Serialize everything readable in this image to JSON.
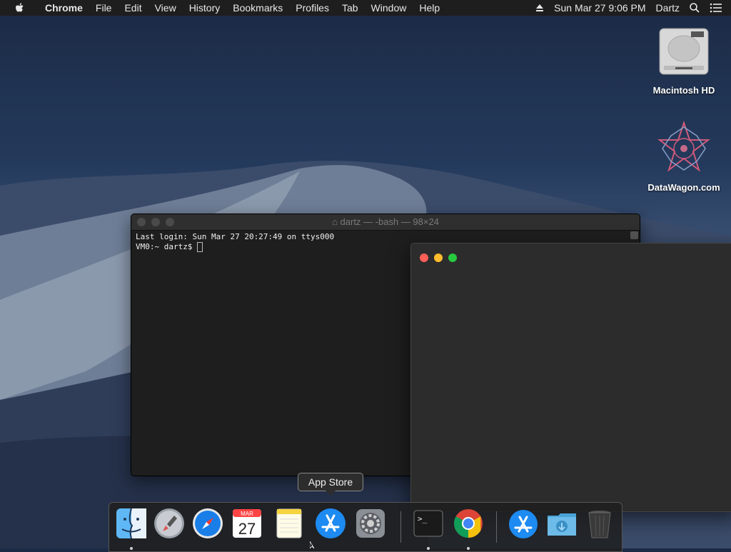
{
  "menubar": {
    "app_name": "Chrome",
    "items": [
      "File",
      "Edit",
      "View",
      "History",
      "Bookmarks",
      "Profiles",
      "Tab",
      "Window",
      "Help"
    ],
    "clock": "Sun Mar 27  9:06 PM",
    "user": "Dartz"
  },
  "desktop": {
    "icons": [
      {
        "label": "Macintosh HD",
        "icon": "hard-drive-icon"
      },
      {
        "label": "DataWagon.com",
        "icon": "datawagon-logo-icon"
      }
    ]
  },
  "terminal": {
    "title": "dartz — -bash — 98×24",
    "lines": [
      "Last login: Sun Mar 27 20:27:49 on ttys000",
      "VM0:~ dartz$ "
    ]
  },
  "tooltip": "App Store",
  "dock": {
    "items": [
      {
        "name": "Finder",
        "icon": "finder-icon",
        "running": true
      },
      {
        "name": "Launchpad",
        "icon": "launchpad-icon",
        "running": false
      },
      {
        "name": "Safari",
        "icon": "safari-icon",
        "running": false
      },
      {
        "name": "Calendar",
        "icon": "calendar-icon",
        "running": false,
        "month": "MAR",
        "day": "27"
      },
      {
        "name": "Notes",
        "icon": "notes-icon",
        "running": false
      },
      {
        "name": "App Store",
        "icon": "app-store-icon",
        "running": false
      },
      {
        "name": "System Preferences",
        "icon": "system-preferences-icon",
        "running": false
      },
      {
        "name": "Terminal",
        "icon": "terminal-icon",
        "running": true
      },
      {
        "name": "Google Chrome",
        "icon": "chrome-icon",
        "running": true
      },
      {
        "name": "Downloads stack",
        "icon": "app-store-download-icon",
        "running": false
      },
      {
        "name": "Downloads",
        "icon": "downloads-folder-icon",
        "running": false
      },
      {
        "name": "Trash",
        "icon": "trash-icon",
        "running": false
      }
    ]
  },
  "colors": {
    "close": "#fe5f57",
    "minimize": "#febc2e",
    "zoom": "#28c840",
    "safari_blue": "#1a7ee8",
    "chrome_red": "#db4437",
    "chrome_yellow": "#f4c20d",
    "chrome_green": "#0f9d58"
  }
}
